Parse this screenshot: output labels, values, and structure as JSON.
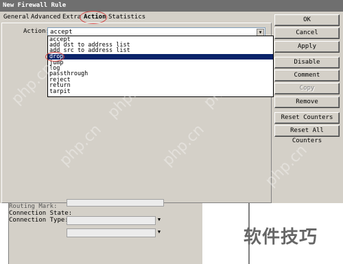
{
  "window": {
    "title": "New Firewall Rule"
  },
  "tabs": [
    {
      "label": "General"
    },
    {
      "label": "Advanced"
    },
    {
      "label": "Extra"
    },
    {
      "label": "Action"
    },
    {
      "label": "Statistics"
    }
  ],
  "action": {
    "label": "Action:",
    "value": "accept",
    "options": [
      "accept",
      "add dst to address list",
      "add src to address list",
      "drop",
      "jump",
      "log",
      "passthrough",
      "reject",
      "return",
      "tarpit"
    ],
    "selected_index": 3
  },
  "side_buttons": {
    "ok": "OK",
    "cancel": "Cancel",
    "apply": "Apply",
    "disable": "Disable",
    "comment": "Comment",
    "copy": "Copy",
    "remove": "Remove",
    "reset_counters": "Reset Counters",
    "reset_all_counters": "Reset All Counters"
  },
  "lower": {
    "truncated": "Routing Mark:",
    "connection_state": "Connection State:",
    "connection_type": "Connection Type:"
  },
  "watermark": {
    "brand": "软件技巧",
    "site": "php.cn"
  },
  "colors": {
    "selection": "#0a246a",
    "titlebar": "#6f6f6f",
    "highlight_ring": "#d04040"
  }
}
